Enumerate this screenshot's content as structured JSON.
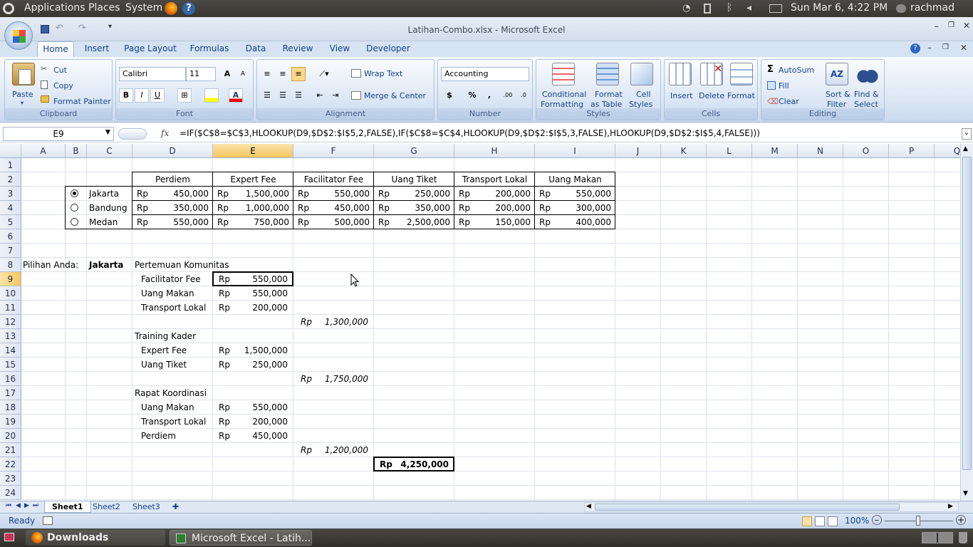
{
  "topbar": {
    "menus": [
      "Applications",
      "Places",
      "System"
    ],
    "datetime": "Sun Mar  6,  4:22 PM",
    "user": "rachmad"
  },
  "window": {
    "title": "Latihan-Combo.xlsx - Microsoft Excel"
  },
  "ribbon_tabs": [
    "Home",
    "Insert",
    "Page Layout",
    "Formulas",
    "Data",
    "Review",
    "View",
    "Developer"
  ],
  "clipboard": {
    "paste": "Paste",
    "cut": "Cut",
    "copy": "Copy",
    "format_painter": "Format Painter",
    "label": "Clipboard"
  },
  "font": {
    "name": "Calibri",
    "size": "11",
    "label": "Font",
    "bold": "B",
    "italic": "I",
    "underline": "U"
  },
  "alignment": {
    "wrap_text": "Wrap Text",
    "merge_center": "Merge & Center",
    "label": "Alignment"
  },
  "number": {
    "format": "Accounting",
    "currency": "$",
    "percent": "%",
    "comma": ",",
    "label": "Number"
  },
  "styles": {
    "conditional_1": "Conditional",
    "conditional_2": "Formatting",
    "format_table_1": "Format",
    "format_table_2": "as Table",
    "cell_styles_1": "Cell",
    "cell_styles_2": "Styles",
    "label": "Styles"
  },
  "cells": {
    "insert": "Insert",
    "delete": "Delete",
    "format": "Format",
    "label": "Cells"
  },
  "editing": {
    "autosum": "AutoSum",
    "fill": "Fill",
    "clear": "Clear",
    "sort_1": "Sort &",
    "sort_2": "Filter",
    "find_1": "Find &",
    "find_2": "Select",
    "label": "Editing"
  },
  "formula_bar": {
    "name_box": "E9",
    "fx": "fx",
    "formula": "=IF($C$8=$C$3,HLOOKUP(D9,$D$2:$I$5,2,FALSE),IF($C$8=$C$4,HLOOKUP(D9,$D$2:$I$5,3,FALSE),HLOOKUP(D9,$D$2:$I$5,4,FALSE)))"
  },
  "columns": [
    "A",
    "B",
    "C",
    "D",
    "E",
    "F",
    "G",
    "H",
    "I",
    "J",
    "K",
    "L",
    "M",
    "N",
    "O",
    "P",
    "Q"
  ],
  "rows": [
    "1",
    "2",
    "3",
    "4",
    "5",
    "6",
    "7",
    "8",
    "9",
    "10",
    "11",
    "12",
    "13",
    "14",
    "15",
    "16",
    "17",
    "18",
    "19",
    "20",
    "21",
    "22",
    "23",
    "24"
  ],
  "sheet": {
    "headers": [
      "Perdiem",
      "Expert Fee",
      "Facilitator Fee",
      "Uang Tiket",
      "Transport Lokal",
      "Uang Makan"
    ],
    "currency": "Rp",
    "cities": [
      {
        "name": "Jakarta",
        "selected": true,
        "values": [
          "450,000",
          "1,500,000",
          "550,000",
          "250,000",
          "200,000",
          "550,000"
        ]
      },
      {
        "name": "Bandung",
        "selected": false,
        "values": [
          "350,000",
          "1,000,000",
          "450,000",
          "350,000",
          "200,000",
          "300,000"
        ]
      },
      {
        "name": "Medan",
        "selected": false,
        "values": [
          "550,000",
          "750,000",
          "500,000",
          "2,500,000",
          "150,000",
          "400,000"
        ]
      }
    ],
    "pilihan_label": "Pilihan Anda:",
    "pilihan_value": "Jakarta",
    "sections": [
      {
        "title": "Pertemuan Komunitas",
        "items": [
          [
            "Facilitator Fee",
            "550,000"
          ],
          [
            "Uang Makan",
            "550,000"
          ],
          [
            "Transport Lokal",
            "200,000"
          ]
        ],
        "subtotal": "1,300,000"
      },
      {
        "title": "Training Kader",
        "items": [
          [
            "Expert Fee",
            "1,500,000"
          ],
          [
            "Uang Tiket",
            "250,000"
          ]
        ],
        "subtotal": "1,750,000"
      },
      {
        "title": "Rapat Koordinasi",
        "items": [
          [
            "Uang Makan",
            "550,000"
          ],
          [
            "Transport Lokal",
            "200,000"
          ],
          [
            "Perdiem",
            "450,000"
          ]
        ],
        "subtotal": "1,200,000"
      }
    ],
    "grand_total": "4,250,000"
  },
  "sheet_tabs": [
    "Sheet1",
    "Sheet2",
    "Sheet3"
  ],
  "status": {
    "ready": "Ready",
    "zoom": "100%"
  },
  "taskbar": {
    "downloads": "Downloads",
    "excel": "Microsoft Excel - Latih..."
  },
  "colors": {
    "accent": "#15428b",
    "selected_header": "#f6c75f"
  }
}
